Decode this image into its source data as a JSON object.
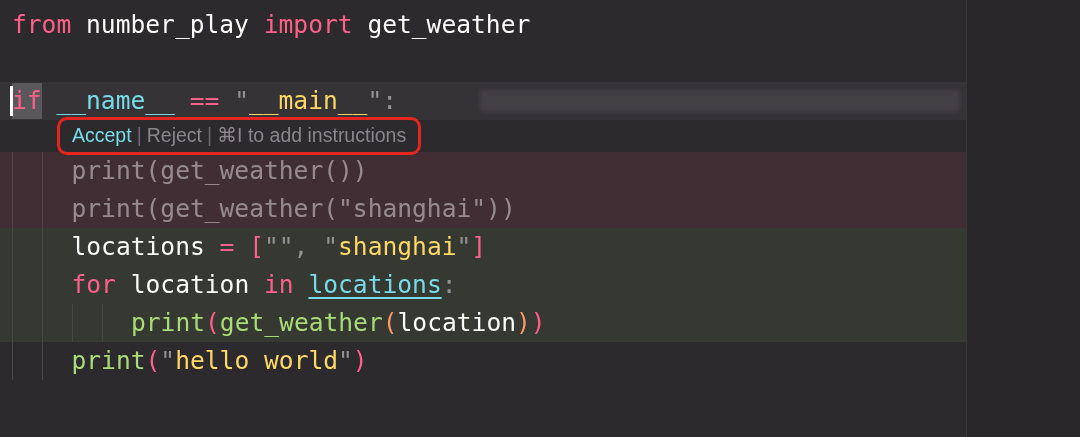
{
  "editor": {
    "lines": [
      {
        "kind": "code",
        "current": false,
        "removed": false,
        "added": false,
        "tokens": [
          {
            "kind": "keyword",
            "text": "from"
          },
          {
            "kind": "plain",
            "text": " number_play "
          },
          {
            "kind": "keyword",
            "text": "import"
          },
          {
            "kind": "plain",
            "text": " get_weather"
          }
        ]
      },
      {
        "kind": "blank",
        "current": false,
        "removed": false,
        "added": false
      },
      {
        "kind": "code",
        "current": true,
        "removed": false,
        "added": false,
        "tokens": [
          {
            "kind": "selected-keyword",
            "text": "if"
          },
          {
            "kind": "dunder",
            "text": " __name__ "
          },
          {
            "kind": "keyword",
            "text": "== "
          },
          {
            "kind": "punct",
            "text": "\""
          },
          {
            "kind": "string",
            "text": "__main__"
          },
          {
            "kind": "punct",
            "text": "\":"
          }
        ],
        "inline_actions": [
          {
            "kind": "accept",
            "text": "Accept"
          },
          {
            "kind": "separator",
            "text": "|"
          },
          {
            "kind": "reject",
            "text": "Reject"
          },
          {
            "kind": "separator",
            "text": "|"
          },
          {
            "kind": "hint",
            "text": "⌘I to add instructions"
          }
        ],
        "children": [
          {
            "kind": "code",
            "current": false,
            "removed": true,
            "added": false,
            "tokens": [
              {
                "kind": "plain",
                "text": "print(get_weather())"
              }
            ]
          },
          {
            "kind": "code",
            "current": false,
            "removed": true,
            "added": false,
            "tokens": [
              {
                "kind": "plain",
                "text": "print(get_weather(\"shanghai\"))"
              }
            ]
          },
          {
            "kind": "code",
            "current": false,
            "removed": false,
            "added": true,
            "tokens": [
              {
                "kind": "plain",
                "text": "locations "
              },
              {
                "kind": "keyword",
                "text": "= ["
              },
              {
                "kind": "punct",
                "text": "\"\", \""
              },
              {
                "kind": "string",
                "text": "shanghai"
              },
              {
                "kind": "punct",
                "text": "\""
              },
              {
                "kind": "keyword",
                "text": "]"
              }
            ]
          },
          {
            "kind": "code",
            "current": false,
            "removed": false,
            "added": true,
            "tokens": [
              {
                "kind": "keyword",
                "text": "for"
              },
              {
                "kind": "plain",
                "text": " location "
              },
              {
                "kind": "keyword",
                "text": "in "
              },
              {
                "kind": "link",
                "text": "locations"
              },
              {
                "kind": "punct",
                "text": ":"
              }
            ],
            "children": [
              {
                "kind": "code",
                "current": false,
                "removed": false,
                "added": true,
                "tokens": [
                  {
                    "kind": "func",
                    "text": "print"
                  },
                  {
                    "kind": "keyword",
                    "text": "("
                  },
                  {
                    "kind": "func",
                    "text": "get_weather"
                  },
                  {
                    "kind": "paren",
                    "text": "("
                  },
                  {
                    "kind": "plain",
                    "text": "location"
                  },
                  {
                    "kind": "paren",
                    "text": ")"
                  },
                  {
                    "kind": "keyword",
                    "text": ")"
                  }
                ]
              }
            ]
          },
          {
            "kind": "code",
            "current": false,
            "removed": false,
            "added": false,
            "tokens": [
              {
                "kind": "func",
                "text": "print"
              },
              {
                "kind": "keyword",
                "text": "("
              },
              {
                "kind": "punct",
                "text": "\""
              },
              {
                "kind": "string",
                "text": "hello world"
              },
              {
                "kind": "punct",
                "text": "\""
              },
              {
                "kind": "keyword",
                "text": ")"
              }
            ]
          }
        ]
      }
    ]
  }
}
